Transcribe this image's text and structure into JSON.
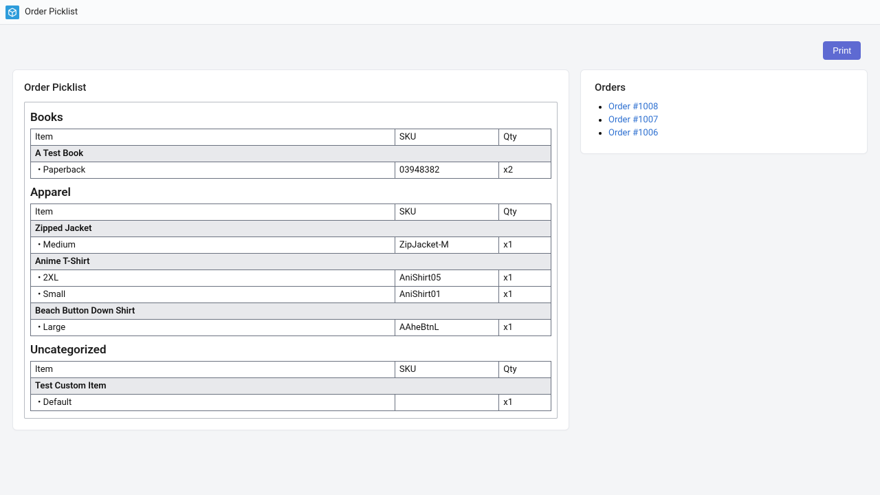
{
  "app": {
    "title": "Order Picklist",
    "icon_name": "box-icon"
  },
  "header": {
    "print_label": "Print"
  },
  "main": {
    "title": "Order Picklist",
    "table_headers": {
      "item": "Item",
      "sku": "SKU",
      "qty": "Qty"
    },
    "categories": [
      {
        "name": "Books",
        "products": [
          {
            "name": "A Test Book",
            "variants": [
              {
                "label": "Paperback",
                "sku": "03948382",
                "qty": "x2"
              }
            ]
          }
        ]
      },
      {
        "name": "Apparel",
        "products": [
          {
            "name": "Zipped Jacket",
            "variants": [
              {
                "label": "Medium",
                "sku": "ZipJacket-M",
                "qty": "x1"
              }
            ]
          },
          {
            "name": "Anime T-Shirt",
            "variants": [
              {
                "label": "2XL",
                "sku": "AniShirt05",
                "qty": "x1"
              },
              {
                "label": "Small",
                "sku": "AniShirt01",
                "qty": "x1"
              }
            ]
          },
          {
            "name": "Beach Button Down Shirt",
            "variants": [
              {
                "label": "Large",
                "sku": "AAheBtnL",
                "qty": "x1"
              }
            ]
          }
        ]
      },
      {
        "name": "Uncategorized",
        "products": [
          {
            "name": "Test Custom Item",
            "variants": [
              {
                "label": "Default",
                "sku": "",
                "qty": "x1"
              }
            ]
          }
        ]
      }
    ]
  },
  "sidebar": {
    "title": "Orders",
    "orders": [
      {
        "label": "Order #1008"
      },
      {
        "label": "Order #1007"
      },
      {
        "label": "Order #1006"
      }
    ]
  },
  "colors": {
    "accent": "#5e6ad2",
    "link": "#2f71d1",
    "bg": "#f4f5f7",
    "icon_bg": "#2d9cdb"
  }
}
